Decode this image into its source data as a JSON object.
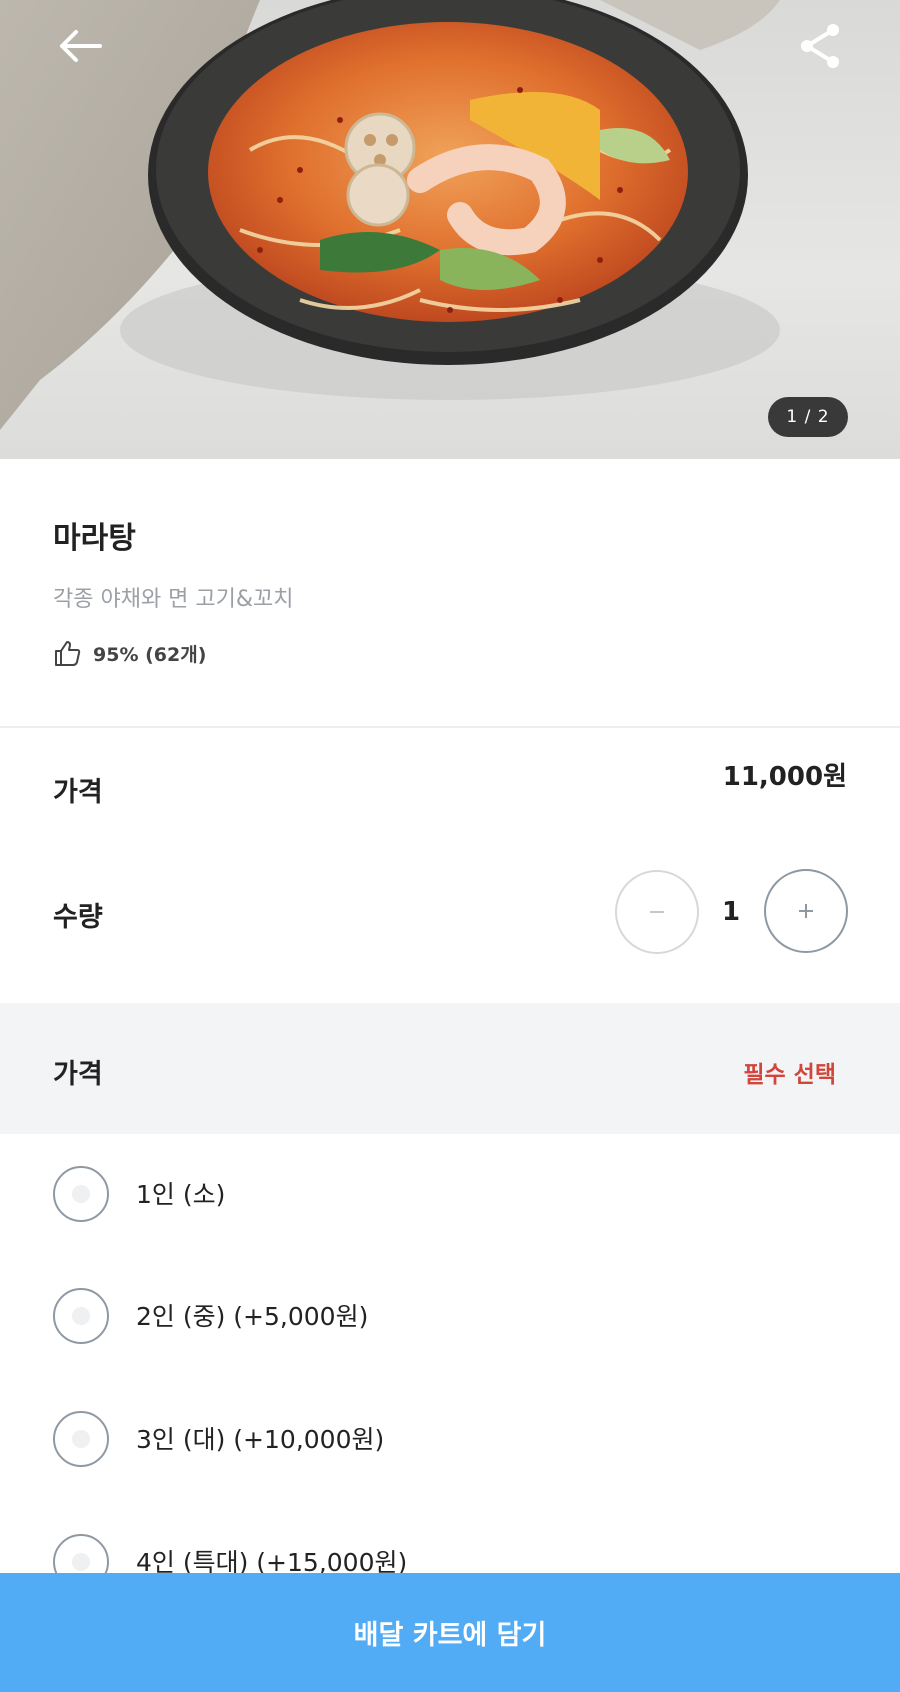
{
  "hero": {
    "image_counter": "1 / 2",
    "back_icon": "arrow-left-icon",
    "share_icon": "share-icon"
  },
  "menu": {
    "name": "마라탕",
    "description": "각종 야채와 면 고기&꼬치",
    "rating_icon": "thumbs-up-icon",
    "rating_text": "95% (62개)"
  },
  "price": {
    "label": "가격",
    "value": "11,000원"
  },
  "quantity": {
    "label": "수량",
    "value": "1",
    "minus_icon": "minus-icon",
    "plus_icon": "plus-icon"
  },
  "option_group": {
    "title": "가격",
    "required_label": "필수 선택",
    "options": [
      {
        "label": "1인 (소)"
      },
      {
        "label": "2인 (중) (+5,000원)"
      },
      {
        "label": "3인 (대) (+10,000원)"
      },
      {
        "label": "4인 (특대) (+15,000원)"
      }
    ]
  },
  "cta": {
    "label": "배달 카트에 담기"
  },
  "colors": {
    "accent": "#52acf5",
    "required": "#d0463b",
    "muted_text": "#9aa0a6",
    "section_bg": "#f3f4f6"
  }
}
